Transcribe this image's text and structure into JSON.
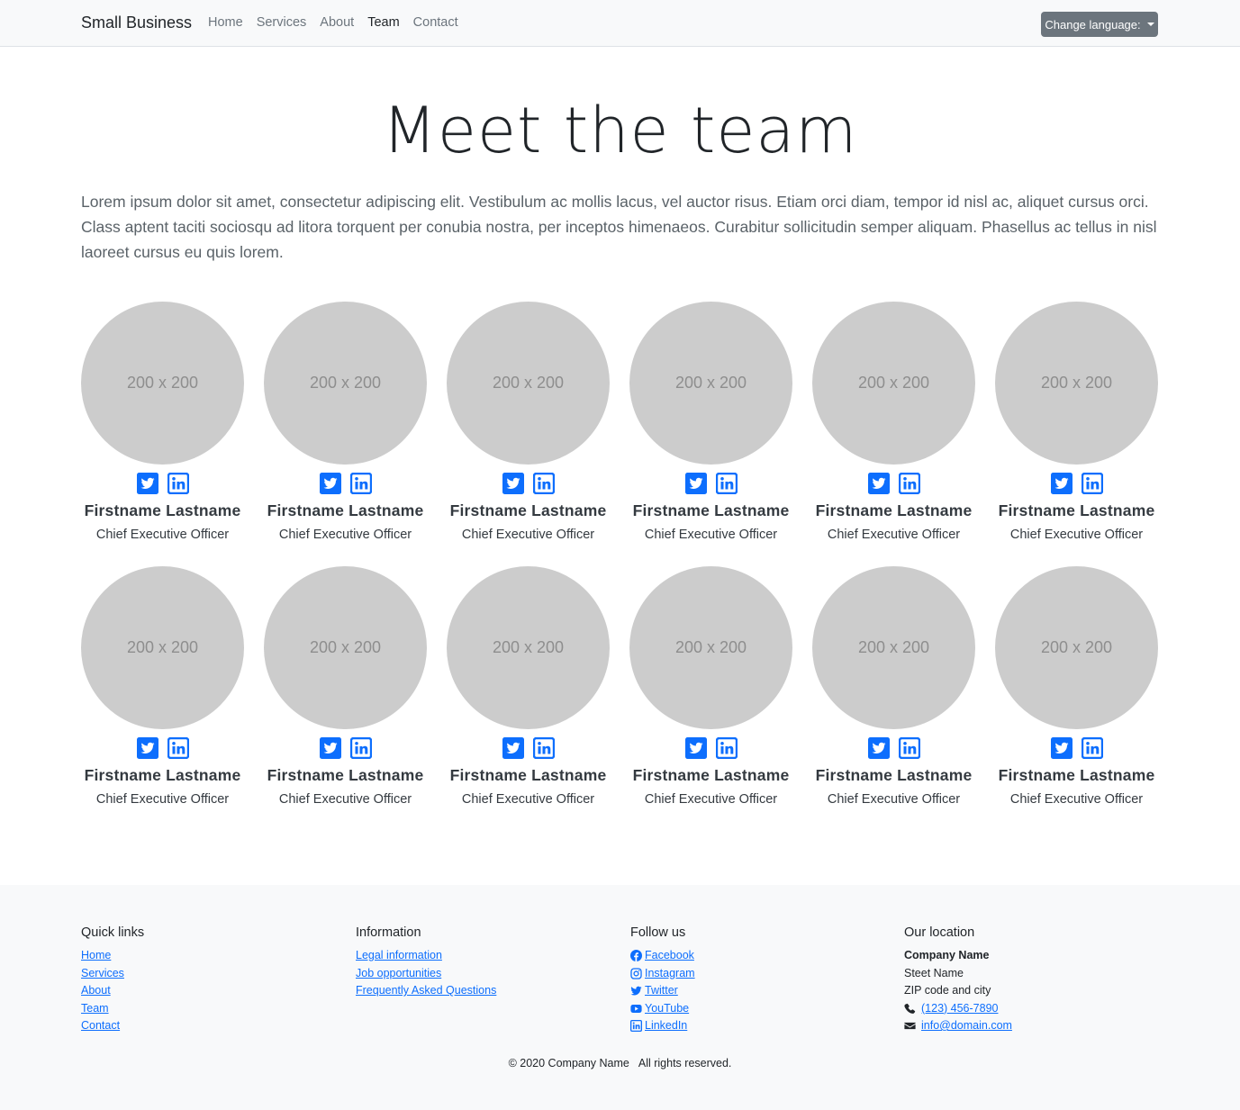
{
  "navbar": {
    "brand": "Small Business",
    "links": [
      {
        "label": "Home"
      },
      {
        "label": "Services"
      },
      {
        "label": "About"
      },
      {
        "label": "Team"
      },
      {
        "label": "Contact"
      }
    ],
    "active": "Team",
    "language_button": "Change language:"
  },
  "header": {
    "title": "Meet the team",
    "lead": "Lorem ipsum dolor sit amet, consectetur adipiscing elit. Vestibulum ac mollis lacus, vel auctor risus. Etiam orci diam, tempor id nisl ac, aliquet cursus orci. Class aptent taciti sociosqu ad litora torquent per conubia nostra, per inceptos himenaeos. Curabitur sollicitudin semper aliquam. Phasellus ac tellus in nisl laoreet cursus eu quis lorem."
  },
  "team": [
    {
      "photo": "200 x 200",
      "name": "Firstname Lastname",
      "role": "Chief Executive Officer"
    },
    {
      "photo": "200 x 200",
      "name": "Firstname Lastname",
      "role": "Chief Executive Officer"
    },
    {
      "photo": "200 x 200",
      "name": "Firstname Lastname",
      "role": "Chief Executive Officer"
    },
    {
      "photo": "200 x 200",
      "name": "Firstname Lastname",
      "role": "Chief Executive Officer"
    },
    {
      "photo": "200 x 200",
      "name": "Firstname Lastname",
      "role": "Chief Executive Officer"
    },
    {
      "photo": "200 x 200",
      "name": "Firstname Lastname",
      "role": "Chief Executive Officer"
    },
    {
      "photo": "200 x 200",
      "name": "Firstname Lastname",
      "role": "Chief Executive Officer"
    },
    {
      "photo": "200 x 200",
      "name": "Firstname Lastname",
      "role": "Chief Executive Officer"
    },
    {
      "photo": "200 x 200",
      "name": "Firstname Lastname",
      "role": "Chief Executive Officer"
    },
    {
      "photo": "200 x 200",
      "name": "Firstname Lastname",
      "role": "Chief Executive Officer"
    },
    {
      "photo": "200 x 200",
      "name": "Firstname Lastname",
      "role": "Chief Executive Officer"
    },
    {
      "photo": "200 x 200",
      "name": "Firstname Lastname",
      "role": "Chief Executive Officer"
    }
  ],
  "member_socials": [
    "twitter-icon",
    "linkedin-icon"
  ],
  "footer": {
    "quick_links": {
      "heading": "Quick links",
      "items": [
        "Home",
        "Services",
        "About",
        "Team",
        "Contact"
      ]
    },
    "information": {
      "heading": "Information",
      "items": [
        "Legal information",
        "Job opportunities",
        "Frequently Asked Questions"
      ]
    },
    "follow_us": {
      "heading": "Follow us",
      "items": [
        {
          "label": " Facebook",
          "icon": "facebook-icon"
        },
        {
          "label": " Instagram",
          "icon": "instagram-icon"
        },
        {
          "label": " Twitter",
          "icon": "twitter-icon"
        },
        {
          "label": " YouTube",
          "icon": "youtube-icon"
        },
        {
          "label": " LinkedIn",
          "icon": "linkedin-icon"
        }
      ]
    },
    "location": {
      "heading": "Our location",
      "company": "Company Name",
      "street": "Steet Name",
      "city": "ZIP code and city",
      "phone": "(123) 456-7890",
      "email": "info@domain.com"
    },
    "copyright": "© 2020 Company Name",
    "rights": "All rights reserved."
  },
  "colors": {
    "link": "#0d6efd",
    "navbar_bg": "#f8f9fa",
    "button_bg": "#6c757d",
    "avatar_bg": "#cccccc"
  }
}
